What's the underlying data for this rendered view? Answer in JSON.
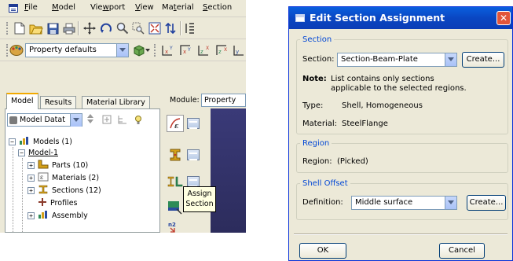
{
  "menubar": {
    "items": [
      {
        "label": "File",
        "underline": "F",
        "rest": "ile"
      },
      {
        "label": "Model",
        "underline": "M",
        "rest": "odel"
      },
      {
        "label": "Viewport",
        "underline": "w",
        "pre": "Vie",
        "rest": "port"
      },
      {
        "label": "View",
        "underline": "V",
        "rest": "iew"
      },
      {
        "label": "Material",
        "underline": "t",
        "pre": "Ma",
        "rest": "erial"
      },
      {
        "label": "Section",
        "underline": "S",
        "rest": "ection"
      }
    ]
  },
  "toolbar": {
    "property_combo": "Property defaults"
  },
  "tabs": [
    {
      "label": "Model"
    },
    {
      "label": "Results"
    },
    {
      "label": "Material Library"
    }
  ],
  "tree": {
    "combo": "Model Datat",
    "nodes": [
      {
        "label": "Models (1)"
      },
      {
        "label": "Model-1"
      },
      {
        "label": "Parts (10)"
      },
      {
        "label": "Materials (2)"
      },
      {
        "label": "Sections (12)"
      },
      {
        "label": "Profiles"
      },
      {
        "label": "Assembly"
      }
    ]
  },
  "module": {
    "label": "Module:",
    "value": "Property"
  },
  "tooltip": {
    "line1": "Assign",
    "line2": "Section"
  },
  "dialog": {
    "title": "Edit Section Assignment",
    "section_group": {
      "legend": "Section",
      "section_label": "Section:",
      "section_value": "Section-Beam-Plate",
      "create_label": "Create...",
      "note_label": "Note:",
      "note_line1": "List contains only sections",
      "note_line2": "applicable to the selected regions.",
      "type_label": "Type:",
      "type_value": "Shell, Homogeneous",
      "material_label": "Material:",
      "material_value": "SteelFlange"
    },
    "region_group": {
      "legend": "Region",
      "region_label": "Region:",
      "region_value": "(Picked)"
    },
    "offset_group": {
      "legend": "Shell Offset",
      "definition_label": "Definition:",
      "definition_value": "Middle surface",
      "create_label": "Create..."
    },
    "ok_label": "OK",
    "cancel_label": "Cancel"
  }
}
